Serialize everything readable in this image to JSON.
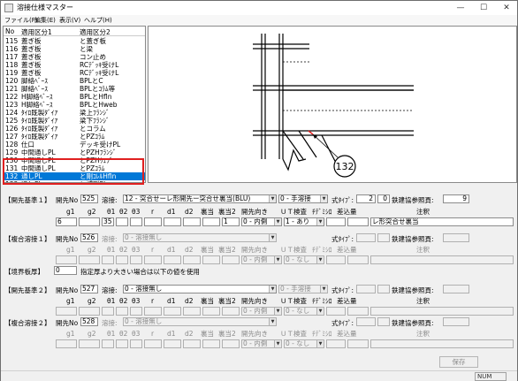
{
  "window": {
    "title": "溶接仕様マスター",
    "minimize": "—",
    "maximize": "☐",
    "close": "✕"
  },
  "menu": [
    "ファイル(F)",
    "編集(E)",
    "表示(V)",
    "ヘルプ(H)"
  ],
  "list": {
    "headers": [
      "No",
      "適用区分1",
      "適用区分2"
    ],
    "rows": [
      [
        "115",
        "蓋ぎ板",
        "と蓋ぎ板"
      ],
      [
        "116",
        "蓋ぎ板",
        "と梁"
      ],
      [
        "117",
        "蓋ぎ板",
        "コン止め"
      ],
      [
        "118",
        "蓋ぎ板",
        "RCﾃﾞｯｷ受けL"
      ],
      [
        "119",
        "蓋ぎ板",
        "RCﾃﾞｯｷ受けL"
      ],
      [
        "120",
        "脚絡ﾍﾞｰｽ",
        "BPLとC"
      ],
      [
        "121",
        "脚絡ﾍﾞｰｽ",
        "BPLとｺﾗﾑ等"
      ],
      [
        "122",
        "H脚絡ﾍﾞｰｽ",
        "BPLとHfln"
      ],
      [
        "123",
        "H脚絡ﾍﾞｰｽ",
        "BPLとHweb"
      ],
      [
        "124",
        "ﾀｲﾛ既製ﾀﾞｲｱ",
        "梁上ﾌﾗﾝｼﾞ"
      ],
      [
        "125",
        "ﾀｲﾛ既製ﾀﾞｲｱ",
        "梁下ﾌﾗﾝｼﾞ"
      ],
      [
        "126",
        "ﾀｲﾛ既製ﾀﾞｲｱ",
        "とコラム"
      ],
      [
        "127",
        "ﾀｲﾛ既製ﾀﾞｲｱ",
        "とPZｺﾗﾑ"
      ],
      [
        "128",
        "仕口",
        "デッキ受けPL"
      ],
      [
        "129",
        "中間通しPL",
        "とPZHﾌﾗﾝｼﾞ"
      ],
      [
        "130",
        "中間通しPL",
        "とPZHｳｪﾌﾞ"
      ],
      [
        "131",
        "中間通しPL",
        "とPZｺﾗﾑ"
      ],
      [
        "132",
        "通しPL",
        "と剛ｺﾚﾙHfln"
      ],
      [
        "133",
        "通しPL",
        "と補剛PL"
      ]
    ],
    "selected_index": 17
  },
  "drawing": {
    "callout": "132"
  },
  "form": {
    "s1": {
      "title": "【開先基準１】",
      "kaisaki_label": "開先No",
      "kaisaki_no": "525",
      "yosetsu_label": "溶接:",
      "yosetsu_value": "12 - 突合せーレ形開先ー突合せ裏当(BLU)",
      "method_value": "0 - 手溶接",
      "shiki_label": "式ﾀｲﾌﾟ:",
      "shiki_a": "2",
      "shiki_b": "0",
      "tekken_label": "鉄建協参照頁:",
      "tekken_value": "9",
      "cols": [
        "g1",
        "g2",
        "θ1",
        "θ2",
        "θ3",
        "r",
        "d1",
        "d2",
        "裏当",
        "裏当2",
        "開先向き",
        "ＵＴ検査",
        "ﾁﾃﾞﾐｼﾛ",
        "差込量",
        "注釈"
      ],
      "vals": {
        "g1": "6",
        "theta1": "35",
        "uratou2": "1",
        "muki": "0 - 内側",
        "ut": "1 - あり",
        "chuushaku": "レ形突合せ裏当"
      }
    },
    "s2": {
      "title": "【複合溶接１】",
      "kaisaki_label": "開先No",
      "kaisaki_no": "526",
      "yosetsu_label": "溶接:",
      "yosetsu_value": "0 - 溶接無し",
      "shiki_label": "式ﾀｲﾌﾟ:",
      "tekken_label": "鉄建協参照頁:",
      "cols": [
        "g1",
        "g2",
        "θ1",
        "θ2",
        "θ3",
        "r",
        "d1",
        "d2",
        "裏当",
        "裏当2",
        "開先向き",
        "ＵＴ検査",
        "ﾁﾃﾞﾐｼﾛ",
        "差込量",
        "注釈"
      ],
      "vals": {
        "muki": "0 - 内側",
        "ut": "0 - なし"
      }
    },
    "border": {
      "title": "【境界板厚】",
      "value": "0",
      "desc": "指定厚より大きい場合は以下の値を使用"
    },
    "s3": {
      "title": "【開先基準２】",
      "kaisaki_label": "開先No",
      "kaisaki_no": "527",
      "yosetsu_label": "溶接:",
      "yosetsu_value": "0 - 溶接無し",
      "method_value": "0 - 手溶接",
      "shiki_label": "式ﾀｲﾌﾟ:",
      "tekken_label": "鉄建協参照頁:",
      "cols": [
        "g1",
        "g2",
        "θ1",
        "θ2",
        "θ3",
        "r",
        "d1",
        "d2",
        "裏当",
        "裏当2",
        "開先向き",
        "ＵＴ検査",
        "ﾁﾃﾞﾐｼﾛ",
        "差込量",
        "注釈"
      ],
      "vals": {
        "muki": "0 - 内側",
        "ut": "0 - なし"
      }
    },
    "s4": {
      "title": "【複合溶接２】",
      "kaisaki_label": "開先No",
      "kaisaki_no": "528",
      "yosetsu_label": "溶接:",
      "yosetsu_value": "0 - 溶接無し",
      "shiki_label": "式ﾀｲﾌﾟ:",
      "tekken_label": "鉄建協参照頁:",
      "cols": [
        "g1",
        "g2",
        "θ1",
        "θ2",
        "θ3",
        "r",
        "d1",
        "d2",
        "裏当",
        "裏当2",
        "開先向き",
        "ＵＴ検査",
        "ﾁﾃﾞﾐｼﾛ",
        "差込量",
        "注釈"
      ],
      "vals": {
        "muki": "0 - 内側",
        "ut": "0 - なし"
      }
    }
  },
  "save_label": "保存",
  "status": {
    "num": "NUM"
  }
}
